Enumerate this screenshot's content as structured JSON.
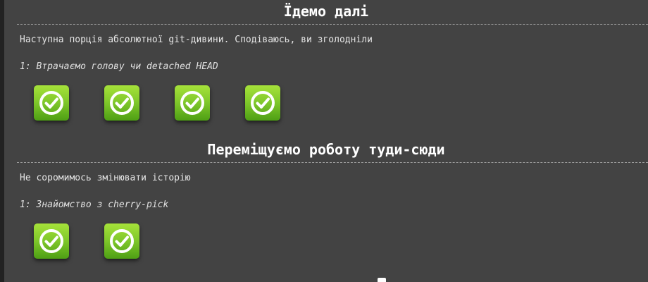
{
  "sections": [
    {
      "title": "Їдемо далі",
      "description": "Наступна порція абсолютної git-дивини. Сподіваюсь, ви зголодніли",
      "subsection": "1: Втрачаємо голову чи detached HEAD",
      "levels": [
        {
          "status": "completed",
          "icon": "check-circle-icon"
        },
        {
          "status": "completed",
          "icon": "check-circle-icon"
        },
        {
          "status": "completed",
          "icon": "check-circle-icon"
        },
        {
          "status": "completed",
          "icon": "check-circle-icon"
        }
      ]
    },
    {
      "title": "Переміщуємо роботу туди-сюди",
      "description": "Не соромимось змінювати історію",
      "subsection": "1: Знайомство з cherry-pick",
      "levels": [
        {
          "status": "completed",
          "icon": "check-circle-icon"
        },
        {
          "status": "completed",
          "icon": "check-circle-icon"
        }
      ]
    }
  ],
  "colors": {
    "background": "#434343",
    "level_complete_top": "#a6e23a",
    "level_complete_bottom": "#4e9f14",
    "divider": "#9a9a9a"
  }
}
